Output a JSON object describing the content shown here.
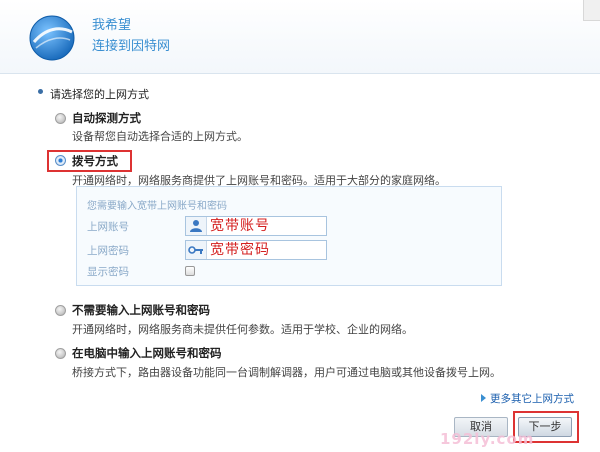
{
  "header": {
    "title": "我希望",
    "subtitle": "连接到因特网"
  },
  "section_label": "请选择您的上网方式",
  "options": [
    {
      "title": "自动探测方式",
      "desc": "设备帮您自动选择合适的上网方式。",
      "checked": false
    },
    {
      "title": "拨号方式",
      "desc": "开通网络时，网络服务商提供了上网账号和密码。适用于大部分的家庭网络。",
      "checked": true
    },
    {
      "title": "不需要输入上网账号和密码",
      "desc": "开通网络时，网络服务商未提供任何参数。适用于学校、企业的网络。",
      "checked": false
    },
    {
      "title": "在电脑中输入上网账号和密码",
      "desc": "桥接方式下，路由器设备功能同一台调制解调器，用户可通过电脑或其他设备拨号上网。",
      "checked": false
    }
  ],
  "credentials": {
    "hint": "您需要输入宽带上网账号和密码",
    "account_label": "上网账号",
    "account_placeholder": "宽带账号",
    "password_label": "上网密码",
    "password_placeholder": "宽带密码",
    "show_password_label": "显示密码"
  },
  "more_link": "更多其它上网方式",
  "buttons": {
    "cancel": "取消",
    "next": "下一步"
  },
  "watermark": "192ly.com",
  "colors": {
    "accent": "#3a8fd1",
    "highlight": "#dd3333",
    "placeholder_text": "#d42020"
  }
}
